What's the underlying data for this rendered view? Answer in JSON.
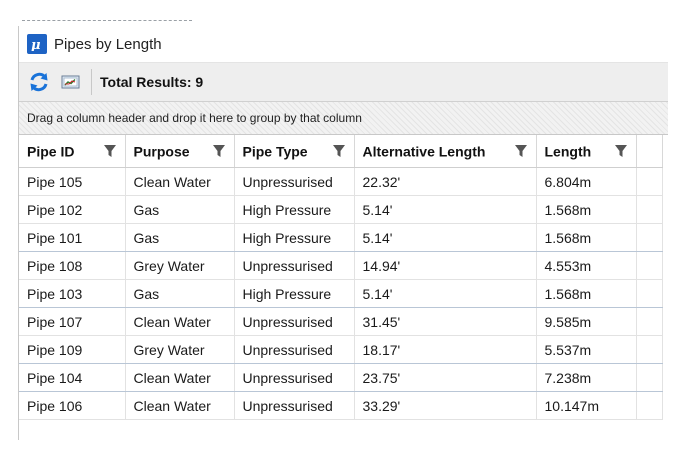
{
  "window": {
    "title": "Pipes by Length"
  },
  "toolbar": {
    "total_results": "Total Results: 9",
    "icons": [
      "refresh-icon",
      "export-chart-icon"
    ]
  },
  "group_panel": {
    "hint": "Drag a column header and drop it here to group by that column"
  },
  "grid": {
    "columns": [
      "Pipe ID",
      "Purpose",
      "Pipe Type",
      "Alternative Length",
      "Length"
    ],
    "rows": [
      [
        "Pipe 105",
        "Clean Water",
        "Unpressurised",
        "22.32'",
        "6.804m"
      ],
      [
        "Pipe 102",
        "Gas",
        "High Pressure",
        "5.14'",
        "1.568m"
      ],
      [
        "Pipe 101",
        "Gas",
        "High Pressure",
        "5.14'",
        "1.568m"
      ],
      [
        "Pipe 108",
        "Grey Water",
        "Unpressurised",
        "14.94'",
        "4.553m"
      ],
      [
        "Pipe 103",
        "Gas",
        "High Pressure",
        "5.14'",
        "1.568m"
      ],
      [
        "Pipe 107",
        "Clean Water",
        "Unpressurised",
        "31.45'",
        "9.585m"
      ],
      [
        "Pipe 109",
        "Grey Water",
        "Unpressurised",
        "18.17'",
        "5.537m"
      ],
      [
        "Pipe 104",
        "Clean Water",
        "Unpressurised",
        "23.75'",
        "7.238m"
      ],
      [
        "Pipe 106",
        "Clean Water",
        "Unpressurised",
        "33.29'",
        "10.147m"
      ]
    ]
  },
  "colors": {
    "app_icon": "#1e63c4",
    "refresh_icon": "#1a73d9",
    "toolbar_bg": "#eeeeee"
  }
}
